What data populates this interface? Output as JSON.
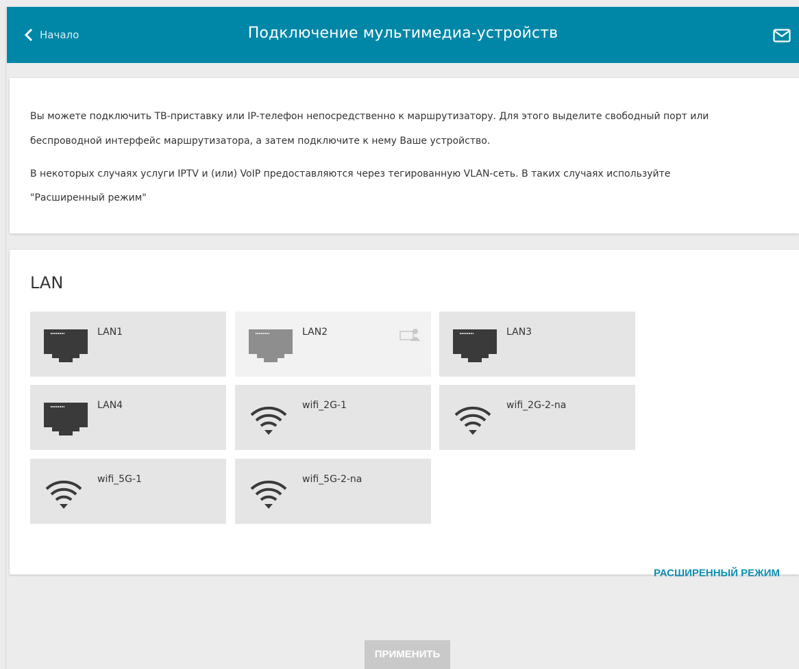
{
  "header": {
    "back_label": "Начало",
    "title": "Подключение мультимедиа-устройств",
    "mail_icon": "mail-icon",
    "background": "#0087a8"
  },
  "info": {
    "paragraph1_line1": "Вы можете подключить ТВ-приставку или IP-телефон непосредственно к маршрутизатору. Для этого выделите свободный порт или",
    "paragraph1_line2": "беспроводной интерфейс маршрутизатора, а затем подключите к нему Ваше устройство.",
    "paragraph2_line1": "В некоторых случаях услуги IPTV и (или) VoIP предоставляются через тегированную VLAN-сеть. В таких случаях используйте",
    "paragraph2_line2": "\"Расширенный режим\""
  },
  "lan": {
    "title": "LAN",
    "interfaces": [
      {
        "label": "LAN1",
        "icon": "ethernet-port-icon",
        "state": "available"
      },
      {
        "label": "LAN2",
        "icon": "ethernet-port-icon",
        "state": "disabled",
        "badge_icon": "workstation-icon"
      },
      {
        "label": "LAN3",
        "icon": "ethernet-port-icon",
        "state": "available"
      },
      {
        "label": "LAN4",
        "icon": "ethernet-port-icon",
        "state": "available"
      },
      {
        "label": "wifi_2G-1",
        "icon": "wifi-icon",
        "state": "available"
      },
      {
        "label": "wifi_2G-2-na",
        "icon": "wifi-icon",
        "state": "available"
      },
      {
        "label": "wifi_5G-1",
        "icon": "wifi-icon",
        "state": "available"
      },
      {
        "label": "wifi_5G-2-na",
        "icon": "wifi-icon",
        "state": "available"
      }
    ],
    "advanced_mode_label": "РАСШИРЕННЫЙ РЕЖИМ",
    "accent_color": "#0c8db0"
  },
  "actions": {
    "apply_label": "ПРИМЕНИТЬ",
    "apply_enabled": false
  }
}
